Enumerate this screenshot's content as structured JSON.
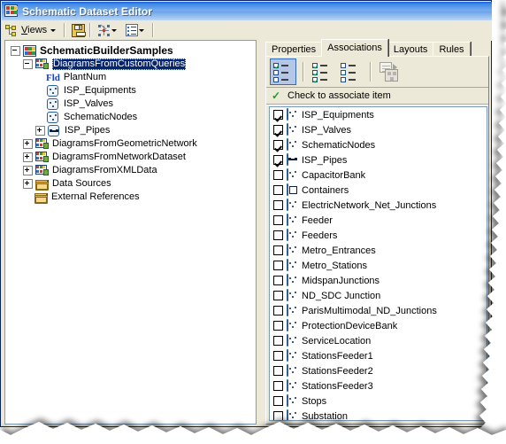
{
  "window": {
    "title": "Schematic Dataset Editor",
    "title_icon": "schematic-dataset-icon"
  },
  "toolbar": {
    "views_label_pre": "V",
    "views_label_accel": "i",
    "views_label_post": "ews",
    "views_label": "Views",
    "views_icon": "views-hierarchy-icon",
    "views_dropdown_icon": "chevron-down-icon",
    "save_icon": "save-floppy-icon",
    "network_icon": "network-diagram-icon",
    "network_dropdown_icon": "chevron-down-icon",
    "properties_icon": "properties-list-icon",
    "properties_dropdown_icon": "chevron-down-icon"
  },
  "tree": {
    "root": {
      "label": "SchematicBuilderSamples",
      "icon": "schematic-dataset-icon",
      "expander": "minus"
    },
    "nodes": [
      {
        "label": "DiagramsFromCustomQueries",
        "icon": "diagram-class-icon",
        "expander": "minus",
        "depth": 1,
        "selected": true
      },
      {
        "label": "PlantNum",
        "icon": "field-icon",
        "icon_text": "Fld",
        "expander": "none",
        "depth": 2,
        "selected": false
      },
      {
        "label": "ISP_Equipments",
        "icon": "point-feature-icon",
        "expander": "none",
        "depth": 2,
        "selected": false
      },
      {
        "label": "ISP_Valves",
        "icon": "point-feature-icon",
        "expander": "none",
        "depth": 2,
        "selected": false
      },
      {
        "label": "SchematicNodes",
        "icon": "point-feature-icon",
        "expander": "none",
        "depth": 2,
        "selected": false
      },
      {
        "label": "ISP_Pipes",
        "icon": "line-feature-icon",
        "expander": "plus",
        "depth": 2,
        "selected": false
      },
      {
        "label": "DiagramsFromGeometricNetwork",
        "icon": "diagram-class-icon",
        "expander": "plus",
        "depth": 1,
        "selected": false
      },
      {
        "label": "DiagramsFromNetworkDataset",
        "icon": "diagram-class-icon",
        "expander": "plus",
        "depth": 1,
        "selected": false
      },
      {
        "label": "DiagramsFromXMLData",
        "icon": "diagram-class-icon",
        "expander": "plus",
        "depth": 1,
        "selected": false
      },
      {
        "label": "Data Sources",
        "icon": "folder-icon",
        "expander": "plus",
        "depth": 1,
        "selected": false
      },
      {
        "label": "External References",
        "icon": "folder-icon",
        "expander": "none",
        "depth": 1,
        "selected": false
      }
    ]
  },
  "tabs": {
    "items": [
      {
        "label": "Properties",
        "active": false
      },
      {
        "label": "Associations",
        "active": true
      },
      {
        "label": "Layouts",
        "active": false
      },
      {
        "label": "Rules",
        "active": false
      }
    ]
  },
  "assoc_toolbar": {
    "buttons": [
      {
        "name": "check-mixed-button",
        "icon": "checklist-mixed-icon",
        "pressed": true
      },
      {
        "name": "check-all-button",
        "icon": "checklist-all-checked-icon",
        "pressed": false
      },
      {
        "name": "uncheck-all-button",
        "icon": "checklist-none-checked-icon",
        "pressed": false
      },
      {
        "name": "copy-associations-button",
        "icon": "copy-associations-icon",
        "pressed": false,
        "disabled": true
      }
    ]
  },
  "hint": {
    "check_icon": "green-check-icon",
    "text": "Check to associate item"
  },
  "associations": {
    "items": [
      {
        "label": "ISP_Equipments",
        "checked": true,
        "icon": "point-feature-icon"
      },
      {
        "label": "ISP_Valves",
        "checked": true,
        "icon": "point-feature-icon"
      },
      {
        "label": "SchematicNodes",
        "checked": true,
        "icon": "point-feature-icon"
      },
      {
        "label": "ISP_Pipes",
        "checked": true,
        "icon": "line-feature-icon"
      },
      {
        "label": "CapacitorBank",
        "checked": false,
        "icon": "point-feature-icon"
      },
      {
        "label": "Containers",
        "checked": false,
        "icon": "container-feature-icon"
      },
      {
        "label": "ElectricNetwork_Net_Junctions",
        "checked": false,
        "icon": "point-feature-icon"
      },
      {
        "label": "Feeder",
        "checked": false,
        "icon": "point-feature-icon"
      },
      {
        "label": "Feeders",
        "checked": false,
        "icon": "point-feature-icon"
      },
      {
        "label": "Metro_Entrances",
        "checked": false,
        "icon": "point-feature-icon"
      },
      {
        "label": "Metro_Stations",
        "checked": false,
        "icon": "point-feature-icon"
      },
      {
        "label": "MidspanJunctions",
        "checked": false,
        "icon": "point-feature-icon"
      },
      {
        "label": "ND_SDC Junction",
        "checked": false,
        "icon": "point-feature-icon"
      },
      {
        "label": "ParisMultimodal_ND_Junctions",
        "checked": false,
        "icon": "point-feature-icon"
      },
      {
        "label": "ProtectionDeviceBank",
        "checked": false,
        "icon": "point-feature-icon"
      },
      {
        "label": "ServiceLocation",
        "checked": false,
        "icon": "point-feature-icon"
      },
      {
        "label": "StationsFeeder1",
        "checked": false,
        "icon": "point-feature-icon"
      },
      {
        "label": "StationsFeeder2",
        "checked": false,
        "icon": "point-feature-icon"
      },
      {
        "label": "StationsFeeder3",
        "checked": false,
        "icon": "point-feature-icon"
      },
      {
        "label": "Stops",
        "checked": false,
        "icon": "point-feature-icon"
      },
      {
        "label": "Substation",
        "checked": false,
        "icon": "point-feature-icon"
      }
    ]
  },
  "colors": {
    "title_bar_start": "#1c5fd0",
    "title_bar_end": "#bcd6f5",
    "window_face": "#ece9d8",
    "selection": "#08246b",
    "pressed_button": "#b5c7e7",
    "pressed_border": "#316ac5",
    "field_text": "#1a3fcc",
    "check_green": "#1a9b2a"
  }
}
